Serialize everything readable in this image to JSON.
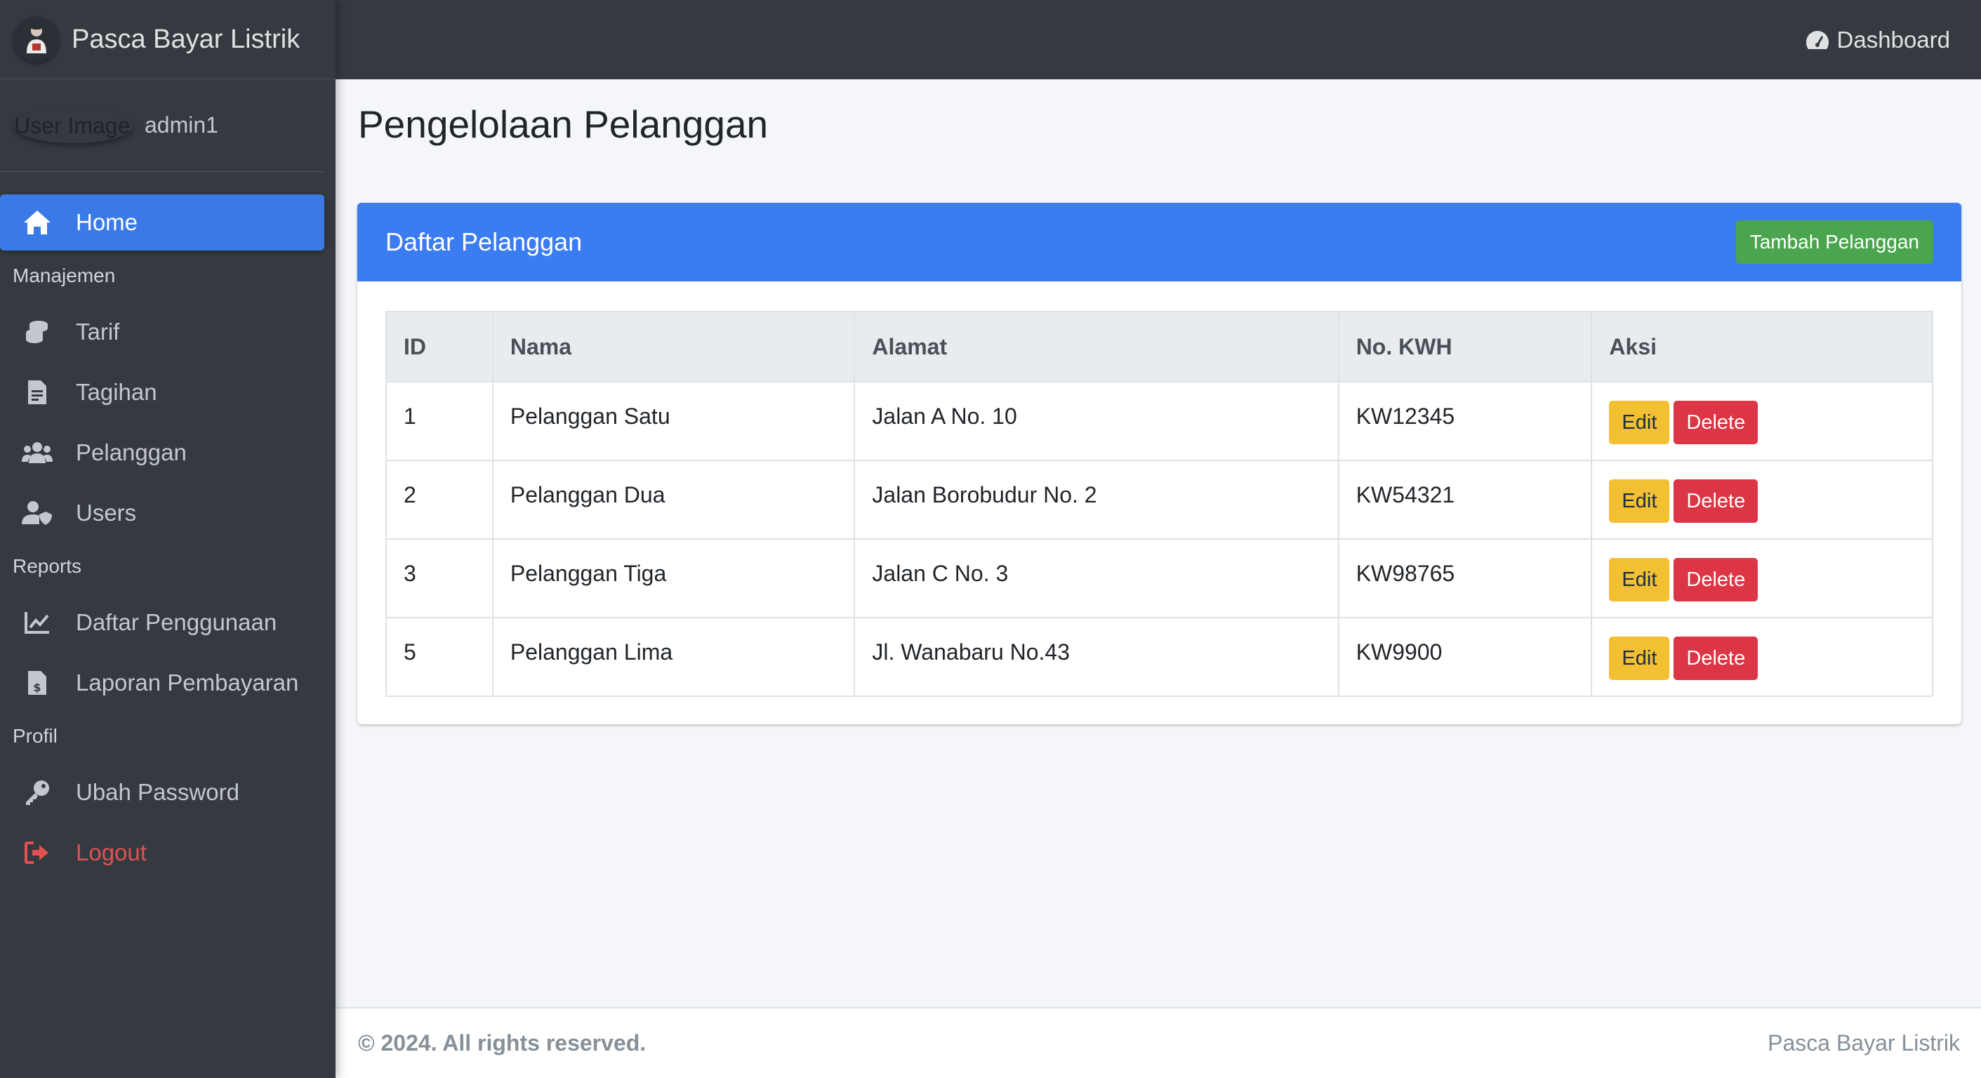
{
  "brand": {
    "title": "Pasca Bayar Listrik"
  },
  "user": {
    "image_alt": "User Image",
    "name": "admin1"
  },
  "sidebar": {
    "home": {
      "label": "Home",
      "icon": "home-icon"
    },
    "sections": [
      {
        "header": "Manajemen",
        "items": [
          {
            "label": "Tarif",
            "icon": "coins-icon"
          },
          {
            "label": "Tagihan",
            "icon": "file-invoice-icon"
          },
          {
            "label": "Pelanggan",
            "icon": "users-icon"
          },
          {
            "label": "Users",
            "icon": "user-shield-icon"
          }
        ]
      },
      {
        "header": "Reports",
        "items": [
          {
            "label": "Daftar Penggunaan",
            "icon": "line-chart-icon"
          },
          {
            "label": "Laporan Pembayaran",
            "icon": "file-dollar-icon"
          }
        ]
      },
      {
        "header": "Profil",
        "items": [
          {
            "label": "Ubah Password",
            "icon": "key-icon"
          },
          {
            "label": "Logout",
            "icon": "logout-icon"
          }
        ]
      }
    ]
  },
  "topbar": {
    "dashboard_label": "Dashboard",
    "icon": "gauge-icon"
  },
  "page": {
    "title": "Pengelolaan Pelanggan"
  },
  "card": {
    "title": "Daftar Pelanggan",
    "add_button": "Tambah Pelanggan",
    "columns": [
      "ID",
      "Nama",
      "Alamat",
      "No. KWH",
      "Aksi"
    ],
    "rows": [
      {
        "id": "1",
        "nama": "Pelanggan Satu",
        "alamat": "Jalan A No. 10",
        "kwh": "KW12345"
      },
      {
        "id": "2",
        "nama": "Pelanggan Dua",
        "alamat": "Jalan Borobudur No. 2",
        "kwh": "KW54321"
      },
      {
        "id": "3",
        "nama": "Pelanggan Tiga",
        "alamat": "Jalan C No. 3",
        "kwh": "KW98765"
      },
      {
        "id": "5",
        "nama": "Pelanggan Lima",
        "alamat": "Jl. Wanabaru No.43",
        "kwh": "KW9900"
      }
    ],
    "edit_label": "Edit",
    "delete_label": "Delete"
  },
  "footer": {
    "copyright": "© 2024. All rights reserved.",
    "app_name": "Pasca Bayar Listrik"
  },
  "colors": {
    "sidebar_bg": "#343a40",
    "primary": "#3b7cf1",
    "success": "#4aa54e",
    "warning": "#f3c034",
    "danger": "#dc3545"
  }
}
